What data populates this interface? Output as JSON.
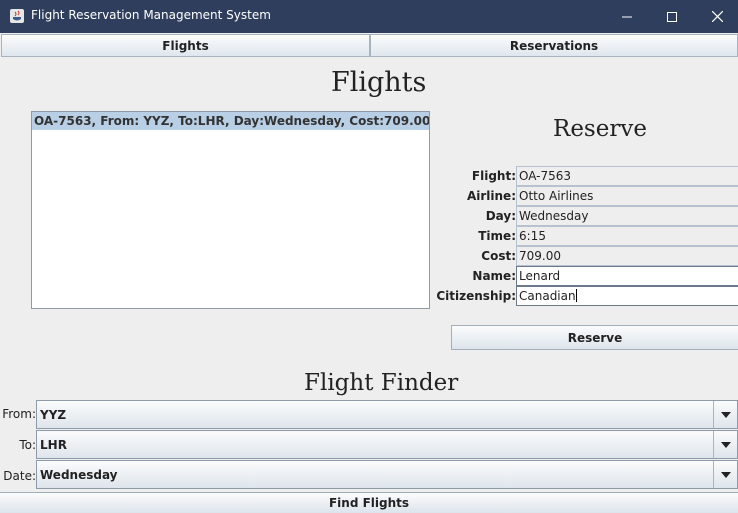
{
  "window": {
    "title": "Flight Reservation Management System",
    "icon": "java-app-icon",
    "controls": [
      "minimize-icon",
      "maximize-icon",
      "close-icon"
    ]
  },
  "tabs": {
    "flights": "Flights",
    "reservations": "Reservations"
  },
  "flights_panel": {
    "heading": "Flights",
    "list": [
      {
        "text": "OA-7563, From: YYZ, To:LHR, Day:Wednesday, Cost:709.00",
        "selected": true
      }
    ]
  },
  "reserve_panel": {
    "heading": "Reserve",
    "fields": {
      "flight": {
        "label": "Flight:",
        "value": "OA-7563"
      },
      "airline": {
        "label": "Airline:",
        "value": "Otto Airlines"
      },
      "day": {
        "label": "Day:",
        "value": "Wednesday"
      },
      "time": {
        "label": "Time:",
        "value": "6:15"
      },
      "cost": {
        "label": "Cost:",
        "value": "709.00"
      },
      "name": {
        "label": "Name:",
        "value": "Lenard"
      },
      "citizenship": {
        "label": "Citizenship:",
        "value": "Canadian"
      }
    },
    "button": "Reserve"
  },
  "finder": {
    "heading": "Flight Finder",
    "from": {
      "label": "From:",
      "value": "YYZ"
    },
    "to": {
      "label": "To:",
      "value": "LHR"
    },
    "date": {
      "label": "Date:",
      "value": "Wednesday"
    },
    "button": "Find Flights"
  },
  "colors": {
    "titlebar": "#2e3e5c",
    "background": "#eeeeee",
    "selection": "#b8cfe5"
  }
}
